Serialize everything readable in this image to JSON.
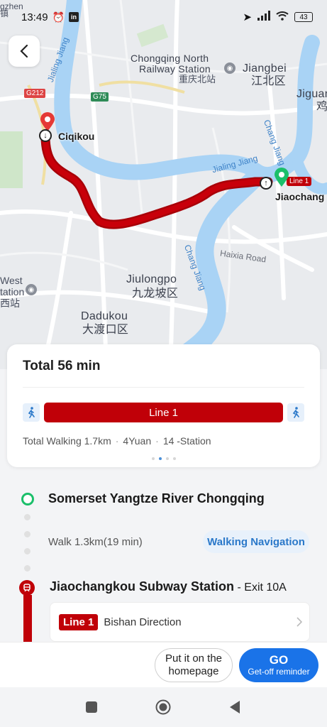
{
  "status_bar": {
    "time": "13:49",
    "battery": "43"
  },
  "map": {
    "labels": {
      "top_left_fragment": "gzhen",
      "top_left_cn": "镇",
      "chongqing_north_1": "Chongqing North",
      "chongqing_north_2": "Railway Station",
      "chongqing_north_cn": "重庆北站",
      "jiangbei": "Jiangbei",
      "jiangbei_cn": "江北区",
      "jiguan_fragment": "Jiguan",
      "jiguan_cn": "鸡",
      "jialing_jiang_vertical": "Jialing Jiang",
      "g212": "G212",
      "g75": "G75",
      "ciqikou": "Ciqikou",
      "chang_jiang_vertical": "Chang Jiang",
      "jialing_jiang_river": "Jialing Jiang",
      "jiaochang": "Jiaochang",
      "line_badge": "Line 1",
      "chang_jiang_lower": "Chang Jiang",
      "haixia_road": "Haixia Road",
      "jiulongpo": "Jiulongpo",
      "jiulongpo_cn": "九龙坡区",
      "west_1": "West",
      "west_2": "tation",
      "west_cn": "西站",
      "dadukou": "Dadukou",
      "dadukou_cn": "大渡口区"
    }
  },
  "route_card": {
    "total": "Total 56 min",
    "line_label": "Line 1",
    "walking": "Total Walking 1.7km",
    "fare": "4Yuan",
    "stations": "14 -Station"
  },
  "steps": {
    "start_title": "Somerset Yangtze River Chongqing",
    "walk_text": "Walk 1.3km(19 min)",
    "walk_nav": "Walking Navigation",
    "station_title": "Jiaochangkou Subway Station",
    "exit": " - Exit 10A",
    "line_chip": "Line 1",
    "direction": "Bishan Direction"
  },
  "actions": {
    "home_label": "Put it on the homepage",
    "go_label": "GO",
    "go_sub": "Get-off reminder"
  },
  "colors": {
    "route_red": "#c00008",
    "accent_blue": "#1a73e8",
    "start_green": "#1bbf6a",
    "river_blue": "#a9d3f5"
  }
}
